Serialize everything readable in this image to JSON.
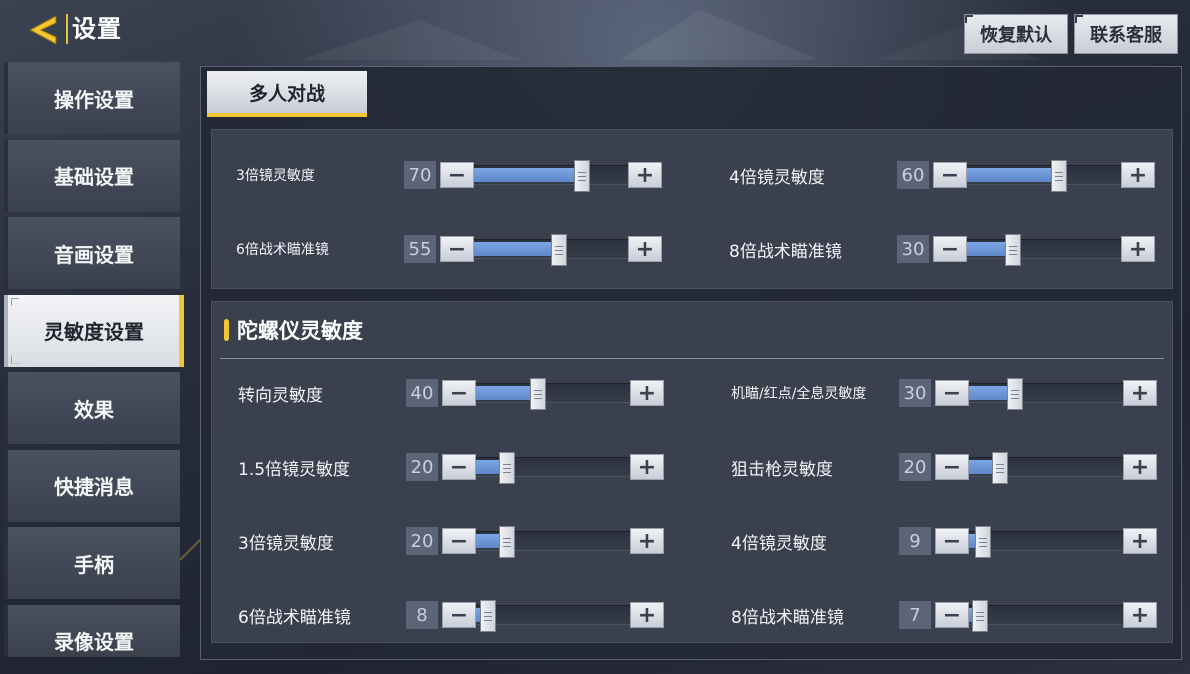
{
  "header": {
    "title": "设置",
    "restore_label": "恢复默认",
    "support_label": "联系客服",
    "accent": "#f3c531"
  },
  "sidebar": {
    "items": [
      {
        "label": "操作设置",
        "active": false
      },
      {
        "label": "基础设置",
        "active": false
      },
      {
        "label": "音画设置",
        "active": false
      },
      {
        "label": "灵敏度设置",
        "active": true
      },
      {
        "label": "效果",
        "active": false
      },
      {
        "label": "快捷消息",
        "active": false
      },
      {
        "label": "手柄",
        "active": false
      },
      {
        "label": "录像设置",
        "active": false
      }
    ]
  },
  "tab": {
    "label": "多人对战"
  },
  "scope_sensitivity": {
    "rows": [
      {
        "label": "3倍镜灵敏度",
        "value": "70",
        "percent": 70
      },
      {
        "label": "4倍镜灵敏度",
        "value": "60",
        "percent": 60
      },
      {
        "label": "6倍战术瞄准镜",
        "value": "55",
        "percent": 55
      },
      {
        "label": "8倍战术瞄准镜",
        "value": "30",
        "percent": 30
      }
    ]
  },
  "gyro_sensitivity": {
    "title": "陀螺仪灵敏度",
    "rows": [
      {
        "label": "转向灵敏度",
        "value": "40",
        "percent": 40
      },
      {
        "label": "机瞄/红点/全息灵敏度",
        "value": "30",
        "percent": 30
      },
      {
        "label": "1.5倍镜灵敏度",
        "value": "20",
        "percent": 20
      },
      {
        "label": "狙击枪灵敏度",
        "value": "20",
        "percent": 20
      },
      {
        "label": "3倍镜灵敏度",
        "value": "20",
        "percent": 20
      },
      {
        "label": "4倍镜灵敏度",
        "value": "9",
        "percent": 9
      },
      {
        "label": "6倍战术瞄准镜",
        "value": "8",
        "percent": 8
      },
      {
        "label": "8倍战术瞄准镜",
        "value": "7",
        "percent": 7
      }
    ]
  },
  "controls": {
    "minus": "−",
    "plus": "+"
  }
}
